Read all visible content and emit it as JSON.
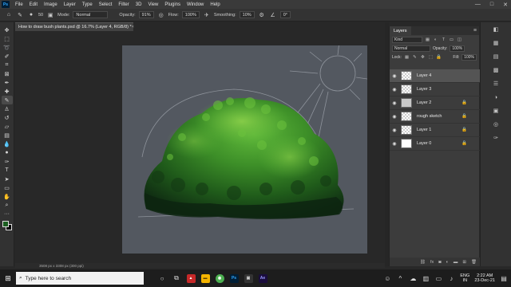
{
  "menubar": {
    "logo": "Ps",
    "items": [
      "File",
      "Edit",
      "Image",
      "Layer",
      "Type",
      "Select",
      "Filter",
      "3D",
      "View",
      "Plugins",
      "Window",
      "Help"
    ],
    "window_controls": [
      "—",
      "□",
      "✕"
    ]
  },
  "options": {
    "brush_size": "50",
    "mode_label": "Mode:",
    "mode_value": "Normal",
    "opacity_label": "Opacity:",
    "opacity_value": "91%",
    "flow_label": "Flow:",
    "flow_value": "100%",
    "smoothing_label": "Smoothing:",
    "smoothing_value": "10%",
    "angle_value": "0°"
  },
  "document": {
    "tab_title": "How to draw bush plants.psd @ 16.7% (Layer 4, RGB/8) *",
    "tab_close": "×",
    "status": "3508 px x 3308 px (300 ppi)"
  },
  "layers_panel": {
    "tab": "Layers",
    "filter_kind": "Kind",
    "blend_mode": "Normal",
    "opacity_label": "Opacity:",
    "opacity_value": "100%",
    "lock_label": "Lock:",
    "fill_label": "Fill:",
    "fill_value": "100%",
    "layers": [
      {
        "name": "Layer 4",
        "thumb": "check",
        "selected": true,
        "locked": false
      },
      {
        "name": "Layer 3",
        "thumb": "check",
        "selected": false,
        "locked": false
      },
      {
        "name": "Layer 2",
        "thumb": "dark",
        "selected": false,
        "locked": true
      },
      {
        "name": "rough sketch",
        "thumb": "check",
        "selected": false,
        "locked": true
      },
      {
        "name": "Layer 1",
        "thumb": "check",
        "selected": false,
        "locked": true
      },
      {
        "name": "Layer 0",
        "thumb": "white",
        "selected": false,
        "locked": true
      }
    ]
  },
  "taskbar": {
    "search_placeholder": "Type here to search",
    "lang_top": "ENG",
    "lang_bottom": "IN",
    "time": "2:22 AM",
    "date": "23-Dec-21"
  },
  "colors": {
    "foreground": "#1b5e20",
    "background": "#000000",
    "canvas": "#535860",
    "accent": "#31a8ff"
  }
}
